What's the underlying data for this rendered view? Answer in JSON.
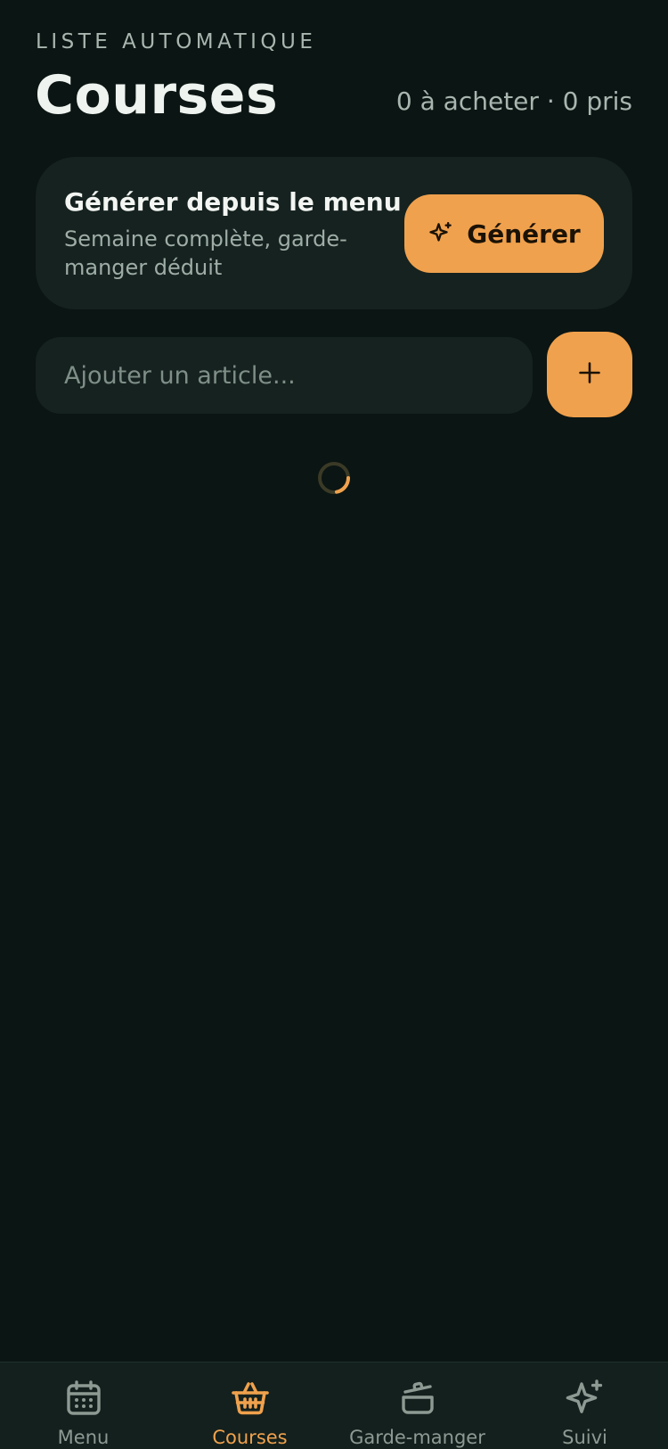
{
  "header": {
    "eyebrow": "LISTE AUTOMATIQUE",
    "title": "Courses",
    "counts": "0 à acheter · 0 pris"
  },
  "generate_card": {
    "title": "Générer depuis le menu",
    "subtitle": "Semaine complète, garde-manger déduit",
    "button_label": "Générer",
    "button_icon": "sparkles-icon"
  },
  "add_item": {
    "placeholder": "Ajouter un article...",
    "value": "",
    "button_icon": "plus-icon"
  },
  "loading": true,
  "tabbar": {
    "active": "courses",
    "items": [
      {
        "id": "menu",
        "label": "Menu",
        "icon": "calendar-icon"
      },
      {
        "id": "courses",
        "label": "Courses",
        "icon": "basket-icon"
      },
      {
        "id": "garde-manger",
        "label": "Garde-manger",
        "icon": "pot-icon"
      },
      {
        "id": "suivi",
        "label": "Suivi",
        "icon": "sparkles-icon"
      }
    ]
  },
  "colors": {
    "background": "#0b1513",
    "card": "#15221f",
    "accent": "#f0a14d",
    "muted_text": "#a9b6b0",
    "inactive_tab": "#8d9a94"
  }
}
